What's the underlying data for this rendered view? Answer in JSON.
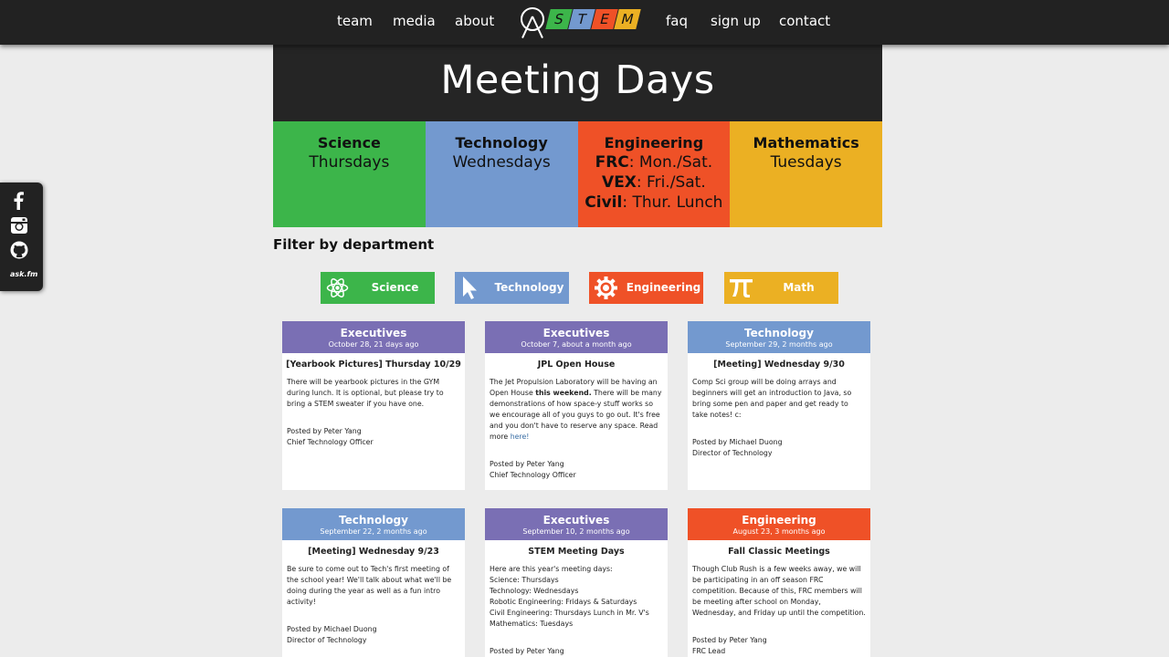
{
  "nav": {
    "left": [
      "team",
      "media",
      "about"
    ],
    "right": [
      "faq",
      "sign up",
      "contact"
    ],
    "logo_letters": [
      "S",
      "T",
      "E",
      "M"
    ]
  },
  "meeting": {
    "title": "Meeting Days",
    "departments": [
      {
        "name": "Science",
        "lines": [
          {
            "bold": "",
            "text": "Thursdays"
          }
        ],
        "color": "#3cb54a"
      },
      {
        "name": "Technology",
        "lines": [
          {
            "bold": "",
            "text": "Wednesdays"
          }
        ],
        "color": "#7399cf"
      },
      {
        "name": "Engineering",
        "lines": [
          {
            "bold": "FRC",
            "text": ": Mon./Sat."
          },
          {
            "bold": "VEX",
            "text": ": Fri./Sat."
          },
          {
            "bold": "Civil",
            "text": ": Thur. Lunch"
          }
        ],
        "color": "#ef5127"
      },
      {
        "name": "Mathematics",
        "lines": [
          {
            "bold": "",
            "text": "Tuesdays"
          }
        ],
        "color": "#ebb023"
      }
    ]
  },
  "social": {
    "askfm": "ask.fm",
    "icons": [
      "facebook-icon",
      "instagram-icon",
      "github-icon"
    ]
  },
  "filter": {
    "title": "Filter by department",
    "buttons": [
      {
        "label": "Science",
        "icon": "atom-icon",
        "color": "#3cb54a"
      },
      {
        "label": "Technology",
        "icon": "cursor-icon",
        "color": "#7399cf"
      },
      {
        "label": "Engineering",
        "icon": "gear-icon",
        "color": "#ef5127"
      },
      {
        "label": "Math",
        "icon": "pi-icon",
        "color": "#ebb023"
      }
    ]
  },
  "colors": {
    "executives": "#7a6fb4",
    "technology": "#7399cf",
    "engineering": "#ef5127"
  },
  "posts": [
    {
      "category": "Executives",
      "date": "October 28, 21 days ago",
      "color": "#7a6fb4",
      "title": "[Yearbook Pictures] Thursday 10/29",
      "body": [
        "There will be yearbook pictures in the GYM during lunch. It is optional, but please try to bring a STEM sweater if you have one."
      ],
      "author": "Posted by Peter Yang",
      "role": "Chief Technology Officer"
    },
    {
      "category": "Executives",
      "date": "October 7, about a month ago",
      "color": "#7a6fb4",
      "title": "JPL Open House",
      "body_pre": "The Jet Propulsion Laboratory will be having an Open House ",
      "body_bold": "this weekend.",
      "body_post": " There will be many demonstrations of how space-y stuff works so we encourage all of you guys to go out. It's free and you don't have to reserve any space. Read more ",
      "body_link": "here!",
      "author": "Posted by Peter Yang",
      "role": "Chief Technology Officer"
    },
    {
      "category": "Technology",
      "date": "September 29, 2 months ago",
      "color": "#7399cf",
      "title": "[Meeting] Wednesday 9/30",
      "body": [
        "Comp Sci group will be doing arrays and beginners will get an introduction to Java, so bring some pen and paper and get ready to take notes! c:"
      ],
      "author": "Posted by Michael Duong",
      "role": "Director of Technology"
    },
    {
      "category": "Technology",
      "date": "September 22, 2 months ago",
      "color": "#7399cf",
      "title": "[Meeting] Wednesday 9/23",
      "body": [
        "Be sure to come out to Tech's first meeting of the school year! We'll talk about what we'll be doing during the year as well as a fun intro activity!"
      ],
      "author": "Posted by Michael Duong",
      "role": "Director of Technology"
    },
    {
      "category": "Executives",
      "date": "September 10, 2 months ago",
      "color": "#7a6fb4",
      "title": "STEM Meeting Days",
      "body": [
        "Here are this year's meeting days:",
        "Science: Thursdays",
        "Technology: Wednesdays",
        "Robotic Engineering: Fridays & Saturdays",
        "Civil Engineering: Thursdays Lunch in Mr. V's",
        "Mathematics: Tuesdays"
      ],
      "author": "Posted by Peter Yang",
      "role": ""
    },
    {
      "category": "Engineering",
      "date": "August 23, 3 months ago",
      "color": "#ef5127",
      "title": "Fall Classic Meetings",
      "body": [
        "Though Club Rush is a few weeks away, we will be participating in an off season FRC competition. Because of this, FRC members will be meeting after school on Monday, Wednesday, and Friday up until the competition."
      ],
      "author": "Posted by Peter Yang",
      "role": "FRC Lead"
    }
  ]
}
